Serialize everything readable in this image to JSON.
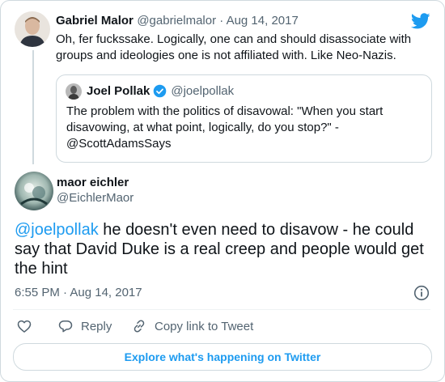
{
  "parent_tweet": {
    "name": "Gabriel Malor",
    "handle_date": "@gabrielmalor · Aug 14, 2017",
    "text_line1": "Oh, fer fuckssake. Logically, one can and should disassociate with",
    "text_line2": "groups and ideologies one is not affiliated with. Like Neo-Nazis."
  },
  "quoted_tweet": {
    "name": "Joel Pollak",
    "handle": "@joelpollak",
    "text_line1": "The problem with the politics of disavowal: \"When you start",
    "text_line2": "disavowing, at what point, logically, do you stop?\" -",
    "text_line3": "@ScottAdamsSays"
  },
  "main_tweet": {
    "name": "maor eichler",
    "handle": "@EichlerMaor",
    "mention": "@joelpollak",
    "text_line1_rest": " he doesn't even need to disavow - he could",
    "text_line2": "say that David Duke is a real creep and people would get",
    "text_line3": "the hint",
    "timestamp": "6:55 PM · Aug 14, 2017"
  },
  "actions": {
    "reply": "Reply",
    "copy_link": "Copy link to Tweet"
  },
  "explore_label": "Explore what's happening on Twitter",
  "colors": {
    "twitter_blue": "#1d9bf0",
    "verified": "#1d9bf0",
    "border": "#cfd9de",
    "muted": "#536471"
  },
  "icons": [
    "twitter-bird-icon",
    "verified-badge-icon",
    "info-icon",
    "heart-icon",
    "reply-icon",
    "link-icon"
  ]
}
